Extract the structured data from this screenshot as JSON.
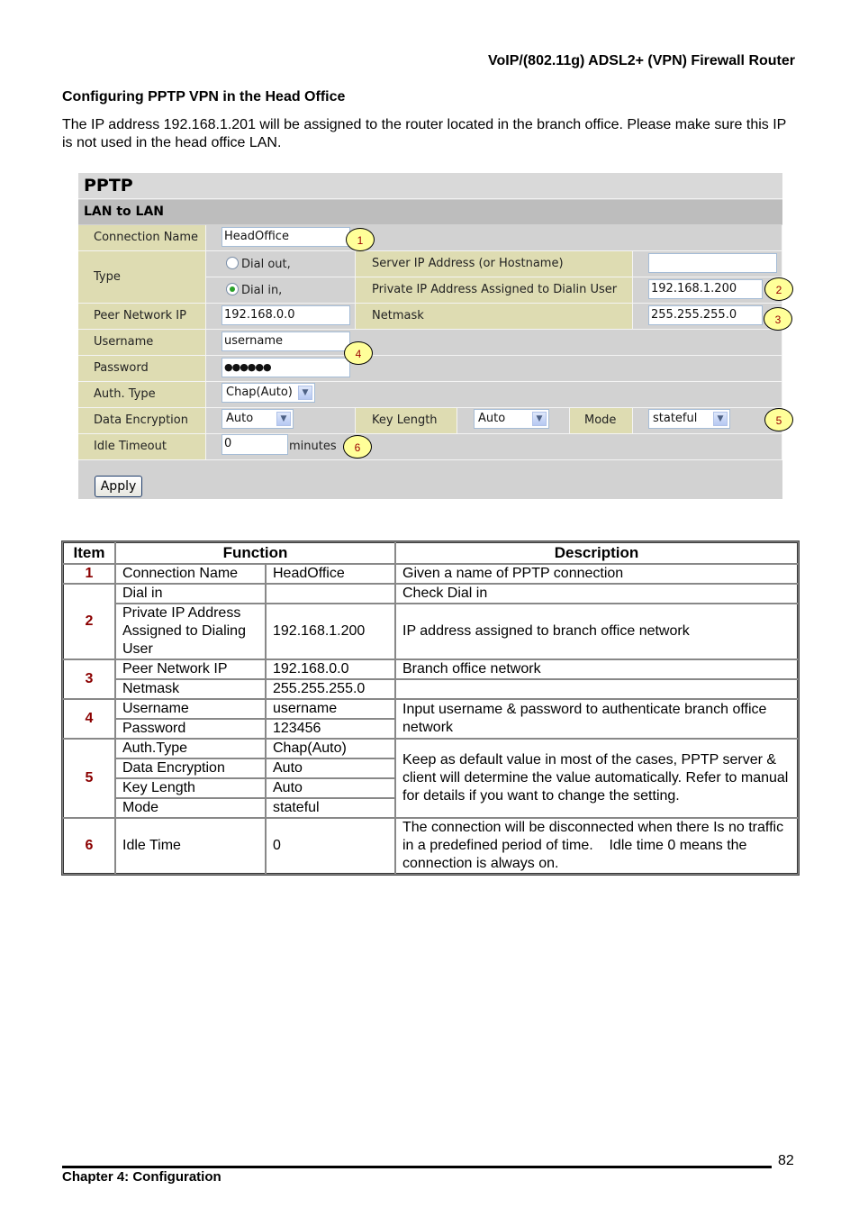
{
  "header": {
    "doc_title": "VoIP/(802.11g) ADSL2+ (VPN) Firewall Router"
  },
  "section": {
    "title": "Configuring PPTP VPN in the Head Office",
    "intro": "The IP address 192.168.1.201 will be assigned to the router located in the branch office. Please make sure this IP is not used in the head office LAN."
  },
  "pptp_panel": {
    "title": "PPTP",
    "subtitle": "LAN to LAN",
    "connection_name": {
      "label": "Connection Name",
      "value": "HeadOffice"
    },
    "type": {
      "label": "Type",
      "options": [
        {
          "label": "Dial out,",
          "selected": false
        },
        {
          "label": "Dial in,",
          "selected": true
        }
      ]
    },
    "server_ip": {
      "label": "Server IP Address (or Hostname)",
      "value": ""
    },
    "private_ip": {
      "label": "Private IP Address Assigned to Dialin User",
      "value": "192.168.1.200"
    },
    "peer_network_ip": {
      "label": "Peer Network IP",
      "value": "192.168.0.0"
    },
    "netmask": {
      "label": "Netmask",
      "value": "255.255.255.0"
    },
    "username": {
      "label": "Username",
      "value": "username"
    },
    "password": {
      "label": "Password",
      "value": "●●●●●●"
    },
    "auth_type": {
      "label": "Auth. Type",
      "value": "Chap(Auto)"
    },
    "data_encryption": {
      "label": "Data Encryption",
      "value": "Auto"
    },
    "key_length": {
      "label": "Key Length",
      "value": "Auto"
    },
    "mode": {
      "label": "Mode",
      "value": "stateful"
    },
    "idle_timeout": {
      "label": "Idle Timeout",
      "value": "0",
      "unit": "minutes"
    },
    "apply_label": "Apply",
    "callouts": [
      "1",
      "2",
      "3",
      "4",
      "5",
      "6"
    ]
  },
  "table": {
    "headers": {
      "item": "Item",
      "function": "Function",
      "description": "Description"
    },
    "rows": [
      {
        "item": "1",
        "function": "Connection Name",
        "value": "HeadOffice",
        "description": "Given a name of PPTP connection"
      },
      {
        "item": "2",
        "function": "Dial in",
        "value": "",
        "description": "Check Dial in"
      },
      {
        "item": "",
        "function": "Private IP Address Assigned to Dialing User",
        "value": "192.168.1.200",
        "description": "IP address assigned to branch office network"
      },
      {
        "item": "3",
        "function": "Peer Network IP",
        "value": "192.168.0.0",
        "description": "Branch office network"
      },
      {
        "item": "",
        "function": "Netmask",
        "value": "255.255.255.0",
        "description": ""
      },
      {
        "item": "4",
        "function": "Username",
        "value": "username",
        "description": "Input username & password to authenticate branch office network"
      },
      {
        "item": "",
        "function": "Password",
        "value": "123456",
        "description": ""
      },
      {
        "item": "5",
        "function": "Auth.Type",
        "value": "Chap(Auto)",
        "description": "Keep as default value in most of the cases, PPTP server & client will determine the value automatically. Refer to manual for details if you want to change the setting."
      },
      {
        "item": "",
        "function": "Data Encryption",
        "value": "Auto",
        "description": ""
      },
      {
        "item": "",
        "function": "Key Length",
        "value": "Auto",
        "description": ""
      },
      {
        "item": "",
        "function": "Mode",
        "value": "stateful",
        "description": ""
      },
      {
        "item": "6",
        "function": "Idle Time",
        "value": "0",
        "description": "The connection will be disconnected when there Is no traffic in a predefined period of time.    Idle time 0 means the connection is always on."
      }
    ]
  },
  "footer": {
    "page_number": "82",
    "chapter": "Chapter 4: Configuration"
  }
}
